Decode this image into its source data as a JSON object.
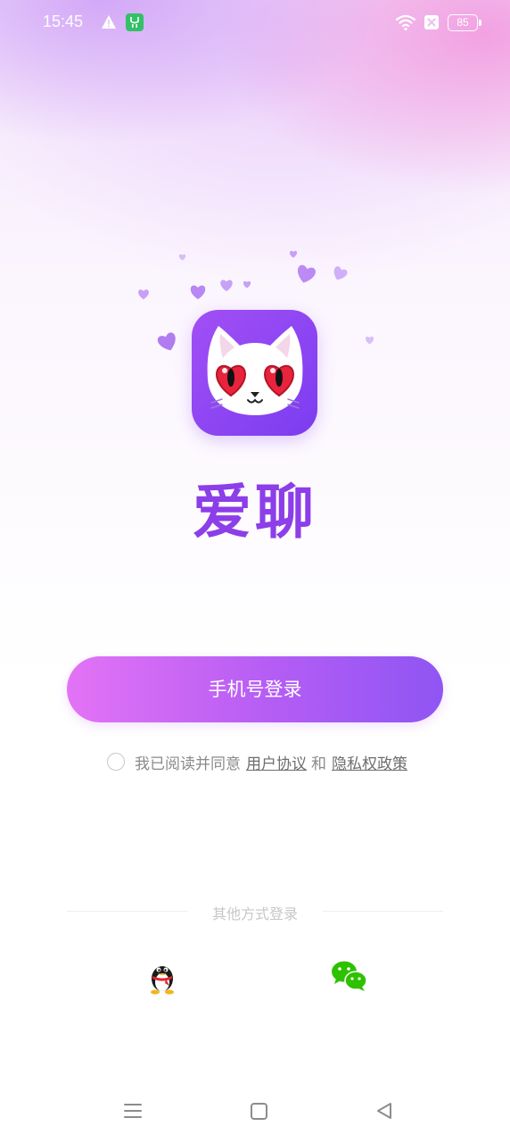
{
  "status_bar": {
    "time": "15:45",
    "battery": "85",
    "icons": [
      "warning-icon",
      "app-notification-icon",
      "wifi-icon",
      "no-sim-icon",
      "battery-icon"
    ]
  },
  "app": {
    "name": "爱聊",
    "logo": "cat-heart-eyes-logo",
    "brand_color": "#8c3ee8"
  },
  "login": {
    "phone_button_label": "手机号登录",
    "agreement_prefix": "我已阅读并同意",
    "user_agreement_link": "用户协议",
    "and_text": "和",
    "privacy_policy_link": "隐私权政策",
    "agreement_checked": false
  },
  "other_login": {
    "label": "其他方式登录",
    "options": [
      {
        "name": "QQ",
        "icon": "qq-penguin-icon"
      },
      {
        "name": "WeChat",
        "icon": "wechat-icon"
      }
    ]
  },
  "nav_bar": {
    "buttons": [
      "menu-icon",
      "home-icon",
      "back-icon"
    ]
  }
}
